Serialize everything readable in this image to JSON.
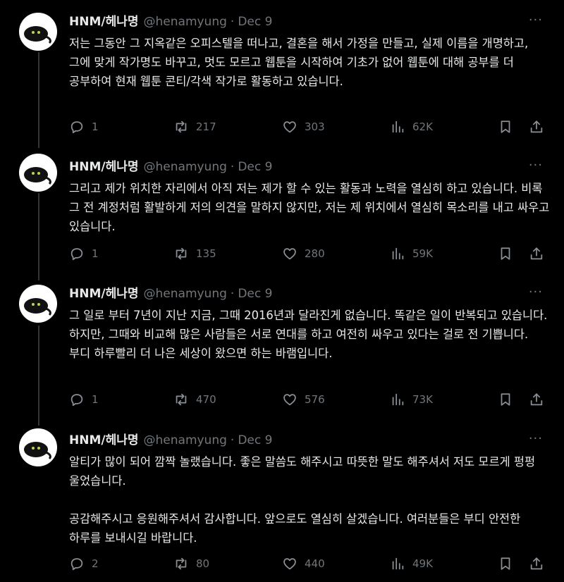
{
  "tweets": [
    {
      "name": "HNM/헤나명",
      "handle": "@henamyung",
      "date": "Dec 9",
      "more": "···",
      "text": "저는 그동안 그 지옥같은 오피스텔을 떠나고, 결혼을 해서 가정을 만들고, 실제 이름을 개명하고, 그에 맞게 작가명도 바꾸고, 멋도 모르고 웹툰을 시작하여 기초가 없어 웹툰에 대해 공부를 더 공부하여 현재 웹툰 콘티/각색 작가로 활동하고 있습니다.",
      "replies": "1",
      "retweets": "217",
      "likes": "303",
      "views": "62K"
    },
    {
      "name": "HNM/헤나명",
      "handle": "@henamyung",
      "date": "Dec 9",
      "more": "···",
      "text": "그리고 제가 위치한 자리에서 아직 저는 제가 할 수 있는 활동과 노력을 열심히 하고 있습니다. 비록 그 전 계정처럼 활발하게 저의 의견을 말하지 않지만, 저는 제 위치에서 열심히 목소리를 내고 싸우고 있습니다.",
      "replies": "1",
      "retweets": "135",
      "likes": "280",
      "views": "59K"
    },
    {
      "name": "HNM/헤나명",
      "handle": "@henamyung",
      "date": "Dec 9",
      "more": "···",
      "text": "그 일로 부터 7년이 지난 지금, 그때 2016년과 달라진게 없습니다. 똑같은 일이 반복되고 있습니다. 하지만, 그때와 비교해 많은 사람들은 서로 연대를 하고 여전히 싸우고 있다는 걸로 전 기쁩니다. 부디 하루빨리 더 나은 세상이 왔으면 하는 바램입니다.",
      "replies": "1",
      "retweets": "470",
      "likes": "576",
      "views": "73K"
    },
    {
      "name": "HNM/헤나명",
      "handle": "@henamyung",
      "date": "Dec 9",
      "more": "···",
      "text": "알티가 많이 되어 깜짝 놀랬습니다. 좋은 말씀도 해주시고 따뜻한 말도 해주셔서 저도 모르게 펑펑 울었습니다.\n\n공감해주시고 응원해주셔서 감사합니다. 앞으로도 열심히 살겠습니다. 여러분들은 부디 안전한 하루를 보내시길 바랍니다.",
      "replies": "2",
      "retweets": "80",
      "likes": "440",
      "views": "49K"
    }
  ],
  "icons": {
    "reply": "speech-bubble-icon",
    "retweet": "retweet-icon",
    "like": "heart-icon",
    "views": "bar-chart-icon",
    "bookmark": "bookmark-icon",
    "share": "share-icon"
  },
  "colors": {
    "background": "#000000",
    "text": "#e7e9ea",
    "muted": "#71767b",
    "thread_line": "#333639"
  }
}
